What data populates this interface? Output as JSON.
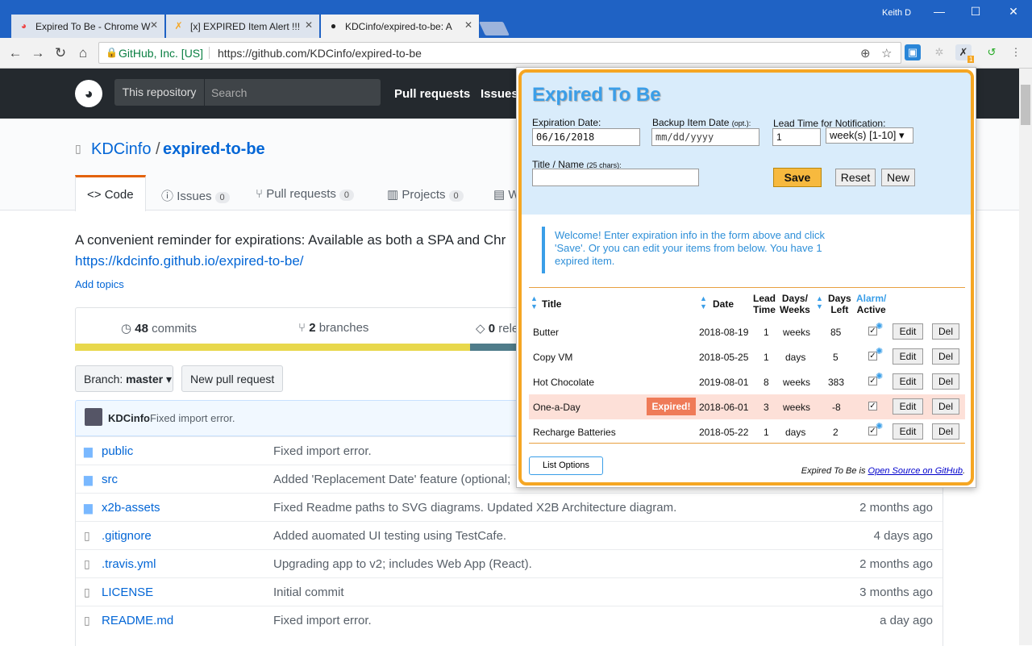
{
  "browser": {
    "tabs": [
      {
        "title": "Expired To Be - Chrome W",
        "icon": "chrome-webstore-icon"
      },
      {
        "title": "[x] EXPIRED Item Alert !!!",
        "icon": "expired-to-be-icon"
      },
      {
        "title": "KDCinfo/expired-to-be: A",
        "icon": "github-icon"
      }
    ],
    "user": "Keith D",
    "secure_label": "GitHub, Inc. [US]",
    "url": "https://github.com/KDCinfo/expired-to-be",
    "ext_badge": "1"
  },
  "github": {
    "this_repository": "This repository",
    "search_placeholder": "Search",
    "nav": [
      "Pull requests",
      "Issues"
    ],
    "owner": "KDCinfo",
    "slash": "/",
    "repo": "expired-to-be",
    "tabs": [
      {
        "label": "Code",
        "count": ""
      },
      {
        "label": "Issues",
        "count": "0"
      },
      {
        "label": "Pull requests",
        "count": "0"
      },
      {
        "label": "Projects",
        "count": "0"
      },
      {
        "label": "W",
        "count": ""
      }
    ],
    "description": "A convenient reminder for expirations: Available as both a SPA and Chr",
    "homepage": "https://kdcinfo.github.io/expired-to-be/",
    "add_topics": "Add topics",
    "stats": {
      "commits_num": "48",
      "commits_label": "commits",
      "branches_num": "2",
      "branches_label": "branches",
      "releases_num": "0",
      "releases_label": "rele"
    },
    "branch_prefix": "Branch:",
    "branch": "master",
    "new_pr": "New pull request",
    "latest_author": "KDCinfo",
    "latest_msg": "Fixed import error.",
    "files": [
      {
        "name": "public",
        "type": "dir",
        "msg": "Fixed import error.",
        "age": ""
      },
      {
        "name": "src",
        "type": "dir",
        "msg": "Added 'Replacement Date' feature (optional;",
        "age": ""
      },
      {
        "name": "x2b-assets",
        "type": "dir",
        "msg": "Fixed Readme paths to SVG diagrams. Updated X2B Architecture diagram.",
        "age": "2 months ago"
      },
      {
        "name": ".gitignore",
        "type": "file",
        "msg": "Added auomated UI testing using TestCafe.",
        "age": "4 days ago"
      },
      {
        "name": ".travis.yml",
        "type": "file",
        "msg": "Upgrading app to v2; includes Web App (React).",
        "age": "2 months ago"
      },
      {
        "name": "LICENSE",
        "type": "file",
        "msg": "Initial commit",
        "age": "3 months ago"
      },
      {
        "name": "README.md",
        "type": "file",
        "msg": "Fixed import error.",
        "age": "a day ago"
      }
    ]
  },
  "popup": {
    "title": "Expired To Be",
    "expiration_label": "Expiration Date:",
    "expiration_value": "06/16/2018",
    "backup_label": "Backup Item Date",
    "backup_opt": "(opt.):",
    "backup_placeholder": "mm/dd/yyyy",
    "lead_label": "Lead Time for Notification:",
    "lead_value": "1",
    "lead_unit": "week(s) [1-10]",
    "title_label": "Title / Name",
    "title_hint": "(25 chars):",
    "title_value": "",
    "save": "Save",
    "reset": "Reset",
    "new": "New",
    "welcome": "Welcome! Enter expiration info in the form above and click 'Save'. Or you can edit your items from below. You have 1 expired item.",
    "headers": {
      "title": "Title",
      "date": "Date",
      "lead1": "Lead",
      "lead2": "Time",
      "days1": "Days/",
      "days2": "Weeks",
      "left1": "Days",
      "left2": "Left",
      "alarm1": "Alarm/",
      "alarm2": "Active"
    },
    "items": [
      {
        "title": "Butter",
        "expired": "",
        "date": "2018-08-19",
        "lead": "1",
        "unit": "weeks",
        "left": "85",
        "active": true
      },
      {
        "title": "Copy VM",
        "expired": "",
        "date": "2018-05-25",
        "lead": "1",
        "unit": "days",
        "left": "5",
        "active": true
      },
      {
        "title": "Hot Chocolate",
        "expired": "",
        "date": "2019-08-01",
        "lead": "8",
        "unit": "weeks",
        "left": "383",
        "active": true
      },
      {
        "title": "One-a-Day",
        "expired": "Expired!",
        "date": "2018-06-01",
        "lead": "3",
        "unit": "weeks",
        "left": "-8",
        "active": false
      },
      {
        "title": "Recharge Batteries",
        "expired": "",
        "date": "2018-05-22",
        "lead": "1",
        "unit": "days",
        "left": "2",
        "active": true
      }
    ],
    "edit": "Edit",
    "del": "Del",
    "list_options": "List Options",
    "footer_prefix": "Expired To Be is ",
    "footer_link": "Open Source on GitHub",
    "footer_suffix": ".",
    "colors": {
      "accent": "#3a9ee8",
      "border": "#f5a623",
      "save": "#f7b93e",
      "expired": "#ef7b58"
    }
  }
}
